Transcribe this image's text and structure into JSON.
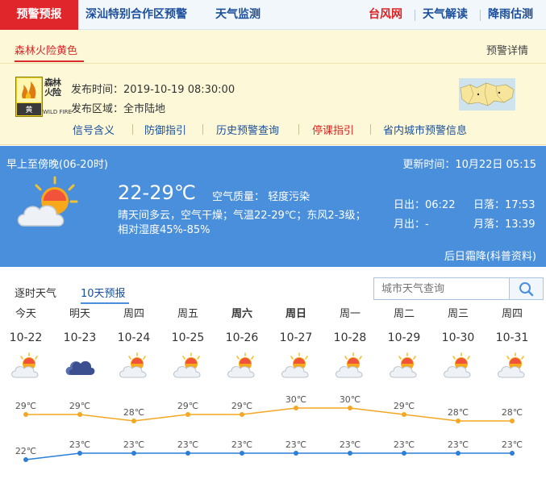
{
  "nav": {
    "active": "预警预报",
    "items": [
      "深汕特别合作区预警",
      "天气监测"
    ],
    "right_items": [
      "台风网",
      "天气解读",
      "降雨估测"
    ]
  },
  "alert": {
    "tab": "森林火险黄色",
    "detail_link": "预警详情",
    "badge_text": "森林火险",
    "badge_level": "黄",
    "badge_en": "WILD FIRE",
    "issue_time_label": "发布时间：",
    "issue_time": "2019-10-19 08:30:00",
    "area_label": "发布区域：",
    "area": "全市陆地",
    "links": [
      "信号含义",
      "防御指引",
      "历史预警查询",
      "停课指引",
      "省内城市预警信息"
    ]
  },
  "weather": {
    "period": "早上至傍晚(06-20时)",
    "updated": "更新时间：10月22日 05:15",
    "temp": "22-29℃",
    "aq_label": "空气质量：",
    "aq_value": "轻度污染",
    "desc_line1": "晴天间多云，空气干燥；气温22-29℃；东风2-3级；",
    "desc_line2": "相对湿度45%-85%",
    "sunrise": "日出：06:22",
    "sunset": "日落：17:53",
    "moonrise": "月出：-",
    "moonset": "月落：13:39",
    "footer_link": "后日霜降(科普资料)"
  },
  "tabs": [
    "逐时天气",
    "10天预报"
  ],
  "search": {
    "placeholder": "城市天气查询"
  },
  "forecast": {
    "days": [
      {
        "name": "今天",
        "date": "10-22",
        "icon": "partly-cloudy-icon",
        "bold": false
      },
      {
        "name": "明天",
        "date": "10-23",
        "icon": "cloudy-icon",
        "bold": false
      },
      {
        "name": "周四",
        "date": "10-24",
        "icon": "partly-cloudy-icon",
        "bold": false
      },
      {
        "name": "周五",
        "date": "10-25",
        "icon": "partly-cloudy-icon",
        "bold": false
      },
      {
        "name": "周六",
        "date": "10-26",
        "icon": "partly-cloudy-icon",
        "bold": true
      },
      {
        "name": "周日",
        "date": "10-27",
        "icon": "partly-cloudy-icon",
        "bold": true
      },
      {
        "name": "周一",
        "date": "10-28",
        "icon": "partly-cloudy-icon",
        "bold": false
      },
      {
        "name": "周二",
        "date": "10-29",
        "icon": "partly-cloudy-icon",
        "bold": false
      },
      {
        "name": "周三",
        "date": "10-30",
        "icon": "partly-cloudy-icon",
        "bold": false
      },
      {
        "name": "周四",
        "date": "10-31",
        "icon": "partly-cloudy-icon",
        "bold": false
      }
    ],
    "high": [
      29,
      29,
      28,
      29,
      29,
      30,
      30,
      29,
      28,
      28
    ],
    "low": [
      22,
      23,
      23,
      23,
      23,
      23,
      23,
      23,
      23,
      23
    ],
    "unit": "℃",
    "high_color": "#f5a623",
    "low_color": "#2b7fd6"
  }
}
